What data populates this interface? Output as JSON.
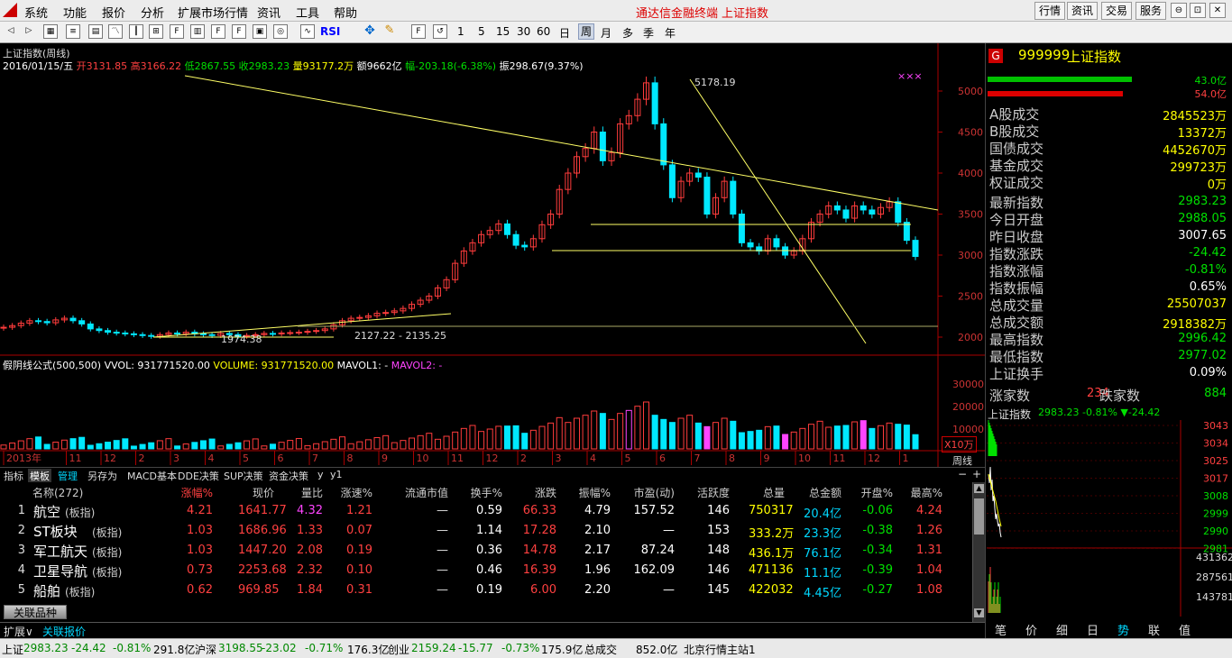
{
  "menu": {
    "items": [
      "系统",
      "功能",
      "报价",
      "分析",
      "扩展市场行情",
      "资讯",
      "工具",
      "帮助"
    ],
    "app_title": "通达信金融终端",
    "page_title": "上证指数",
    "right_buttons": [
      "行情",
      "资讯",
      "交易",
      "服务"
    ],
    "window_buttons": [
      "⊖",
      "⊡",
      "✕"
    ]
  },
  "toolbar": {
    "periods": [
      "1",
      "5",
      "15",
      "30",
      "60",
      "日",
      "周",
      "月",
      "多",
      "季",
      "年"
    ],
    "selected_period": "周",
    "rsi": "RSI"
  },
  "chart": {
    "title": "上证指数(周线)",
    "info_date": "2016/01/15/五",
    "info_open": "开3131.85",
    "info_high": "高3166.22",
    "info_low": "低2867.55",
    "info_close": "收2983.23",
    "info_vol": "量93177.2万",
    "info_amt": "额9662亿",
    "info_change": "幅-203.18(-6.38%)",
    "info_amp": "振298.67(9.37%)",
    "annotation_high": "5178.19",
    "annotation_low": "1974.38",
    "annotation_range": "2127.22 - 2135.25",
    "marks": "×××",
    "yaxis": [
      "5000",
      "4500",
      "4000",
      "3500",
      "3000",
      "2500",
      "2000"
    ],
    "vol_line": "假阴线公式(500,500)  VVOL: 931771520.00",
    "vol_volume": "VOLUME: 931771520.00",
    "vol_mavol1": "MAVOL1: -",
    "vol_mavol2": "MAVOL2: -",
    "vol_axis": [
      "30000",
      "20000",
      "10000"
    ],
    "vol_unit": "X10万",
    "xaxis": [
      "2013年",
      "11",
      "12",
      "2",
      "3",
      "4",
      "5",
      "6",
      "7",
      "8",
      "9",
      "10",
      "11",
      "12",
      "2",
      "3",
      "4",
      "5",
      "6",
      "7",
      "8",
      "9",
      "10",
      "11",
      "12",
      "1"
    ],
    "period_label": "周线"
  },
  "tabs": [
    "指标",
    "模板",
    "管理",
    "另存为",
    "MACD基本",
    "DDE决策",
    "SUP决策",
    "资金决策",
    "y",
    "y1"
  ],
  "table": {
    "headers": [
      "名称(272)",
      "涨幅%",
      "现价",
      "量比",
      "涨速%",
      "流通市值",
      "换手%",
      "涨跌",
      "振幅%",
      "市盈(动)",
      "活跃度",
      "总量",
      "总金额",
      "开盘%",
      "最高%"
    ],
    "rows": [
      [
        "1",
        "航空",
        "(板指)",
        "4.21",
        "1641.77",
        "4.32",
        "1.21",
        "—",
        "0.59",
        "66.33",
        "4.79",
        "157.52",
        "146",
        "750317",
        "20.4亿",
        "-0.06",
        "4.24"
      ],
      [
        "2",
        "ST板块",
        "(板指)",
        "1.03",
        "1686.96",
        "1.33",
        "0.07",
        "—",
        "1.14",
        "17.28",
        "2.10",
        "—",
        "153",
        "333.2万",
        "23.3亿",
        "-0.38",
        "1.26"
      ],
      [
        "3",
        "军工航天",
        "(板指)",
        "1.03",
        "1447.20",
        "2.08",
        "0.19",
        "—",
        "0.36",
        "14.78",
        "2.17",
        "87.24",
        "148",
        "436.1万",
        "76.1亿",
        "-0.34",
        "1.31"
      ],
      [
        "4",
        "卫星导航",
        "(板指)",
        "0.73",
        "2253.68",
        "2.32",
        "0.10",
        "—",
        "0.46",
        "16.39",
        "1.96",
        "162.09",
        "146",
        "471136",
        "11.1亿",
        "-0.39",
        "1.04"
      ],
      [
        "5",
        "船舶",
        "(板指)",
        "0.62",
        "969.85",
        "1.84",
        "0.31",
        "—",
        "0.19",
        "6.00",
        "2.20",
        "—",
        "145",
        "422032",
        "4.45亿",
        "-0.27",
        "1.08"
      ]
    ],
    "footer_tab": "关联品种"
  },
  "bottom_tabs": [
    "扩展∨",
    "关联报价"
  ],
  "right_panel": {
    "code_badge": "G",
    "code": "999999",
    "name": "上证指数",
    "bar1_val": "43.0亿",
    "bar2_val": "54.0亿",
    "stats": [
      {
        "label": "A股成交",
        "value": "2845523万"
      },
      {
        "label": "B股成交",
        "value": "13372万"
      },
      {
        "label": "国债成交",
        "value": "4452670万"
      },
      {
        "label": "基金成交",
        "value": "299723万"
      },
      {
        "label": "权证成交",
        "value": "0万"
      }
    ],
    "quotes": [
      {
        "label": "最新指数",
        "value": "2983.23",
        "color": "#00e000"
      },
      {
        "label": "今日开盘",
        "value": "2988.05",
        "color": "#00e000"
      },
      {
        "label": "昨日收盘",
        "value": "3007.65",
        "color": "#ffffff"
      },
      {
        "label": "指数涨跌",
        "value": "-24.42",
        "color": "#00e000"
      },
      {
        "label": "指数涨幅",
        "value": "-0.81%",
        "color": "#00e000"
      },
      {
        "label": "指数振幅",
        "value": "0.65%",
        "color": "#ffffff"
      },
      {
        "label": "总成交量",
        "value": "25507037",
        "color": "#ffff00"
      },
      {
        "label": "总成交额",
        "value": "2918382万",
        "color": "#ffff00"
      },
      {
        "label": "最高指数",
        "value": "2996.42",
        "color": "#00e000"
      },
      {
        "label": "最低指数",
        "value": "2977.02",
        "color": "#00e000"
      },
      {
        "label": "上证换手",
        "value": "0.09%",
        "color": "#ffffff"
      }
    ],
    "up_label": "涨家数",
    "up_value": "234",
    "down_label": "跌家数",
    "down_value": "884",
    "mini_title": "上证指数",
    "mini_info": "2983.23 -0.81% ▼-24.42",
    "mini_axis": [
      "3043",
      "3034",
      "3025",
      "3017",
      "3008",
      "2999",
      "2990",
      "2981"
    ],
    "mini_vol_axis": [
      "431362",
      "287561",
      "143781"
    ],
    "bottom_tabs": [
      "笔",
      "价",
      "细",
      "日",
      "势",
      "联",
      "值"
    ]
  },
  "status": {
    "sh_label": "上证",
    "sh_price": "2983.23",
    "sh_change": "-24.42",
    "sh_pct": "-0.81%",
    "sh_amt": "291.8亿",
    "hs_label": "沪深",
    "hs_price": "3198.55",
    "hs_change": "-23.02",
    "hs_pct": "-0.71%",
    "hs_amt": "176.3亿",
    "cy_label": "创业",
    "cy_price": "2159.24",
    "cy_change": "-15.77",
    "cy_pct": "-0.73%",
    "cy_amt": "175.9亿",
    "total_label": "总成交",
    "total_amt": "852.0亿",
    "server": "北京行情主站1"
  },
  "colors": {
    "up": "#ff3c3c",
    "down": "#00e8ff",
    "accent": "#ffff00"
  }
}
